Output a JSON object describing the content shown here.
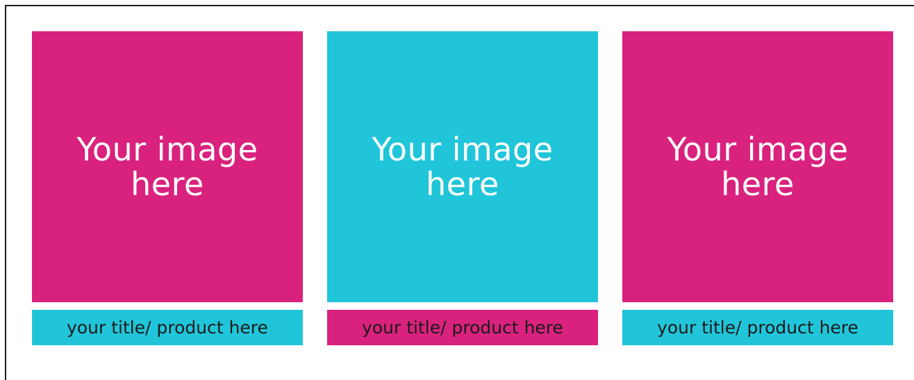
{
  "colors": {
    "magenta": "#d9227e",
    "cyan": "#21c5d9",
    "frame": "#1a1a1a",
    "image_text": "#ffffff",
    "title_text": "#1a1a1a"
  },
  "cards": [
    {
      "image_text": "Your image\nhere",
      "title": "your title/ product here",
      "image_color": "#d9227e",
      "title_color": "#21c5d9"
    },
    {
      "image_text": "Your image\nhere",
      "title": "your title/ product here",
      "image_color": "#21c5d9",
      "title_color": "#d9227e"
    },
    {
      "image_text": "Your image\nhere",
      "title": "your title/ product here",
      "image_color": "#d9227e",
      "title_color": "#21c5d9"
    }
  ]
}
